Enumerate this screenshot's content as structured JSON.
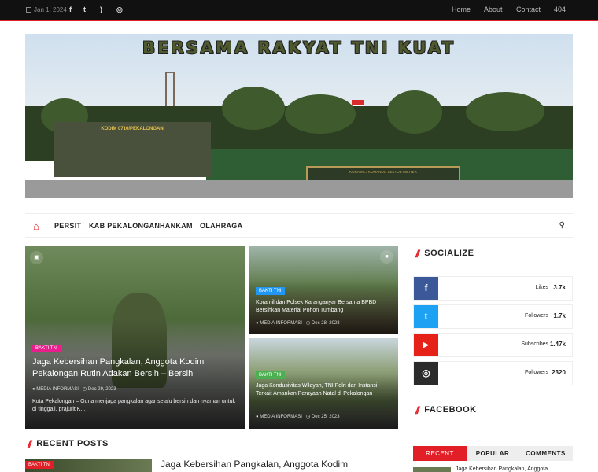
{
  "topbar": {
    "date": "Jan 1, 2024",
    "social_icons": [
      "facebook-icon",
      "twitter-icon",
      "rss-icon",
      "instagram-icon"
    ],
    "nav": [
      "Home",
      "About",
      "Contact",
      "404"
    ]
  },
  "header": {
    "banner_text": "BERSAMA RAKYAT TNI KUAT",
    "gate_text": "KODIM 0710/PEKALONGAN",
    "plaque_text": "KORAMIL / KOMANDO SEKTOR MILITER"
  },
  "mainnav": {
    "items": [
      "PERSIT",
      "KAB PEKALONGAN",
      "HANKAM",
      "OLAHRAGA"
    ]
  },
  "featured": {
    "main": {
      "badge": "BAKTI TNI",
      "title": "Jaga Kebersihan Pangkalan, Anggota Kodim Pekalongan Rutin Adakan Bersih – Bersih",
      "author": "MEDIA INFORMASI",
      "date": "Dec 29, 2023",
      "excerpt": "Kota Pekalongan – Guna menjaga pangkalan agar selalu bersih dan nyaman untuk di tinggali, prajurit K..."
    },
    "top_right": {
      "badge": "BAKTI TNI",
      "title": "Koramil dan Polsek Karanganyar Bersama BPBD Bersihkan Material Pohon Tumbang",
      "author": "MEDIA INFORMASI",
      "date": "Dec 28, 2023"
    },
    "bottom_right": {
      "badge": "BAKTI TNI",
      "title": "Jaga Kondusivitas Wilayah, TNI Polri dan Instansi Terkait Amankan Perayaan Natal di Pekalongan",
      "author": "MEDIA INFORMASI",
      "date": "Dec 25, 2023"
    }
  },
  "recent": {
    "heading": "RECENT POSTS",
    "badge": "BAKTI TNI",
    "title": "Jaga Kebersihan Pangkalan, Anggota Kodim"
  },
  "sidebar": {
    "socialize_heading": "SOCIALIZE",
    "facebook_heading": "FACEBOOK",
    "social": [
      {
        "icon": "facebook-icon",
        "glyph": "f",
        "label": "Likes",
        "count": "3.7k",
        "color": "#3b5998"
      },
      {
        "icon": "twitter-icon",
        "glyph": "t",
        "label": "Followers",
        "count": "1.7k",
        "color": "#1da1f2"
      },
      {
        "icon": "youtube-icon",
        "glyph": "▶",
        "label": "Subscribes",
        "count": "1.47k",
        "color": "#e62117"
      },
      {
        "icon": "instagram-icon",
        "glyph": "◎",
        "label": "Followers",
        "count": "2320",
        "color": "#2b2b2b"
      }
    ],
    "tabs": [
      "RECENT",
      "POPULAR",
      "COMMENTS"
    ],
    "tab_preview": "Jaga Kebersihan Pangkalan, Anggota"
  },
  "colors": {
    "accent": "#e21f26",
    "topbar": "#111111",
    "badge_pink": "#e91e8c",
    "badge_blue": "#2196f3",
    "badge_green": "#4caf50"
  }
}
